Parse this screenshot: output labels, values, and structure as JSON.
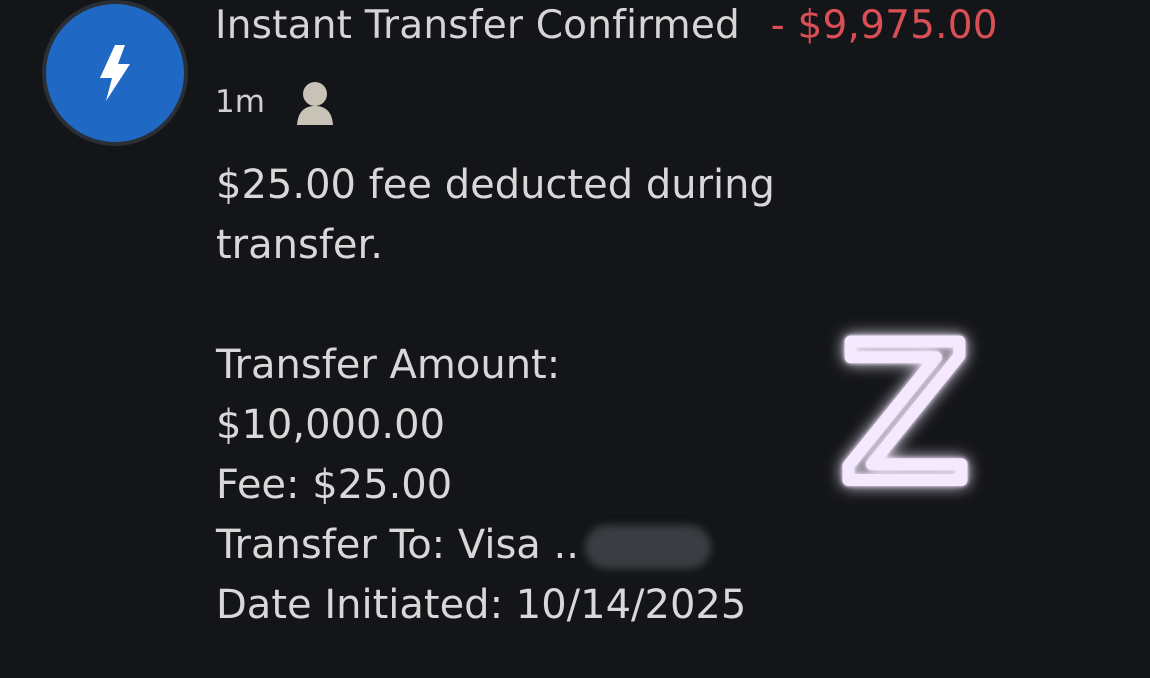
{
  "notification": {
    "icon": "lightning-bolt-icon",
    "title": "Instant Transfer Confirmed",
    "amount": "- $9,975.00",
    "time": "1m",
    "person_icon": "person-icon",
    "message": [
      "$25.00 fee deducted during",
      "transfer."
    ],
    "details": {
      "transfer_amount_label": "Transfer Amount:",
      "transfer_amount_value": "$10,000.00",
      "fee": "Fee: $25.00",
      "transfer_to": "Transfer To: Visa ..",
      "date_initiated": "Date Initiated: 10/14/2025"
    }
  },
  "sticker": {
    "text": "Z"
  },
  "colors": {
    "background": "#131518",
    "avatar": "#1f69c4",
    "amount": "#d84f55",
    "text": "#d8d8d8",
    "sticker_glow": "#d8a8ff"
  }
}
